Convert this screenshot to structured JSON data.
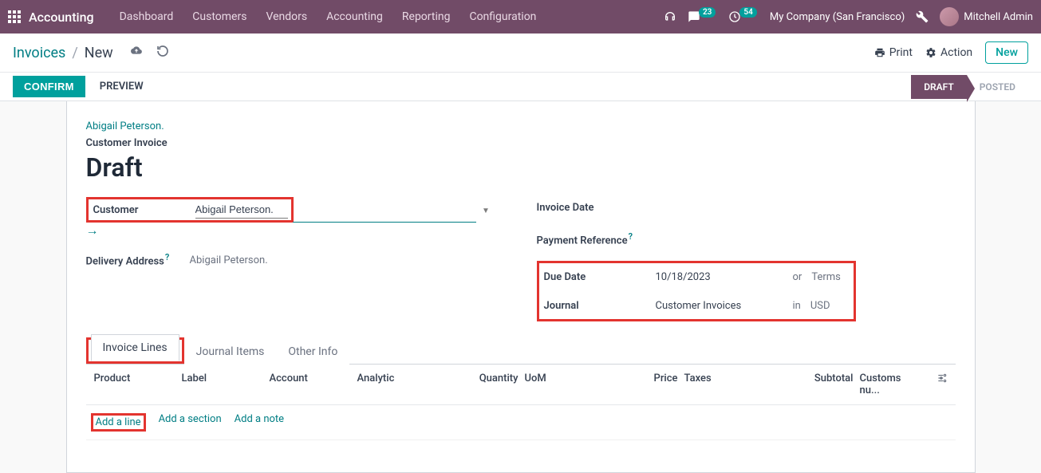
{
  "nav": {
    "brand": "Accounting",
    "items": [
      "Dashboard",
      "Customers",
      "Vendors",
      "Accounting",
      "Reporting",
      "Configuration"
    ],
    "msgCount": "23",
    "timerCount": "54",
    "company": "My Company (San Francisco)",
    "user": "Mitchell Admin"
  },
  "cp": {
    "bc_root": "Invoices",
    "bc_current": "New",
    "print": "Print",
    "action": "Action",
    "new": "New"
  },
  "status": {
    "confirm": "CONFIRM",
    "preview": "PREVIEW",
    "draft": "DRAFT",
    "posted": "POSTED"
  },
  "form": {
    "cust_link": "Abigail Peterson.",
    "doc_type": "Customer Invoice",
    "title": "Draft",
    "customer_label": "Customer",
    "customer_val": "Abigail Peterson.",
    "delivery_label": "Delivery Address",
    "delivery_val": "Abigail Peterson.",
    "invdate_label": "Invoice Date",
    "payref_label": "Payment Reference",
    "due_label": "Due Date",
    "due_val": "10/18/2023",
    "due_or": "or",
    "due_terms": "Terms",
    "journal_label": "Journal",
    "journal_val": "Customer Invoices",
    "journal_in": "in",
    "journal_cur": "USD"
  },
  "tabs": {
    "lines": "Invoice Lines",
    "journal": "Journal Items",
    "other": "Other Info"
  },
  "cols": {
    "product": "Product",
    "label": "Label",
    "account": "Account",
    "analytic": "Analytic",
    "qty": "Quantity",
    "uom": "UoM",
    "price": "Price",
    "taxes": "Taxes",
    "subtotal": "Subtotal",
    "customs": "Customs nu..."
  },
  "actions": {
    "line": "Add a line",
    "section": "Add a section",
    "note": "Add a note"
  }
}
